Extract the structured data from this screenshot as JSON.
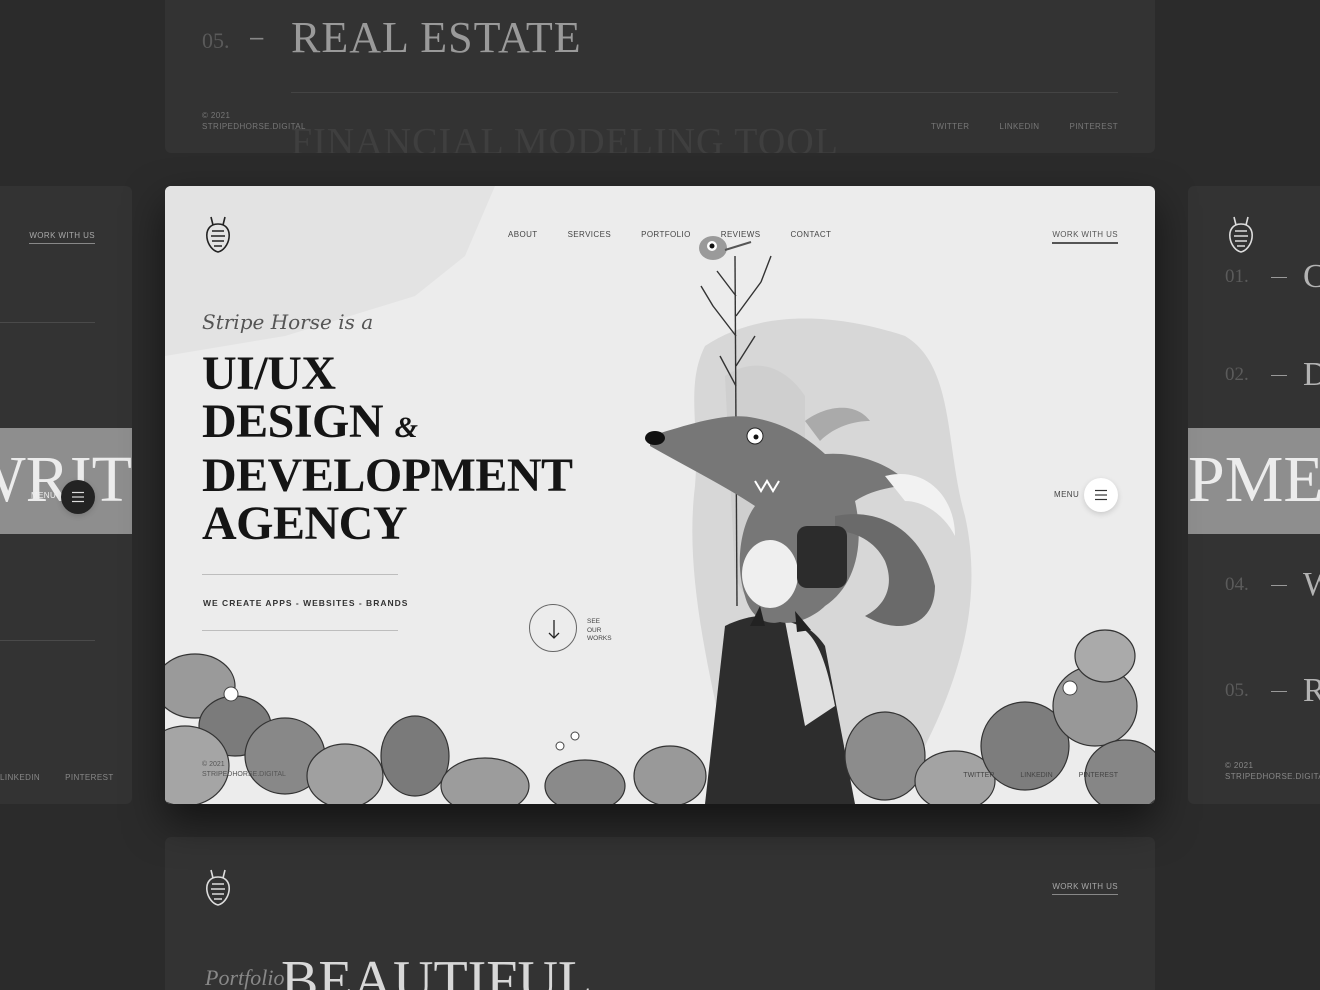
{
  "top_card": {
    "number": "05.",
    "dash": "–",
    "title": "REAL ESTATE",
    "ghost_title": "FINANCIAL MODELING TOOL",
    "copyright": "© 2021",
    "domain": "STRIPEDHORSE.DIGITAL",
    "socials": [
      "TWITTER",
      "LINKEDIN",
      "PINTEREST"
    ]
  },
  "left_card": {
    "work_with_us": "WORK WITH US",
    "band_text": "WRIT",
    "menu_label": "MENU",
    "socials": [
      "LINKEDIN",
      "PINTEREST"
    ]
  },
  "right_card": {
    "items": [
      {
        "num": "01.",
        "label": "C"
      },
      {
        "num": "02.",
        "label": "D"
      },
      {
        "num": "04.",
        "label": "W"
      },
      {
        "num": "05.",
        "label": "R"
      }
    ],
    "band_text": "PMEN",
    "copyright": "© 2021",
    "domain": "STRIPEDHORSE.DIGITAL"
  },
  "main": {
    "nav": [
      "ABOUT",
      "SERVICES",
      "PORTFOLIO",
      "REVIEWS",
      "CONTACT"
    ],
    "work_with_us": "WORK WITH US",
    "tagline": "Stripe Horse is a",
    "hero_line1": "UI/UX",
    "hero_line2": "DESIGN",
    "hero_amp": "&",
    "hero_line3": "DEVELOPMENT",
    "hero_line4": "AGENCY",
    "services_tag": "WE CREATE APPS  -  WEBSITES  -  BRANDS",
    "see_works": [
      "SEE",
      "OUR",
      "WORKS"
    ],
    "menu_label": "MENU",
    "copyright": "© 2021",
    "domain": "STRIPEDHORSE.DIGITAL",
    "socials": [
      "TWITTER",
      "LINKEDIN",
      "PINTEREST"
    ]
  },
  "bottom_card": {
    "work_with_us": "WORK WITH US",
    "script": "Portfolio",
    "title": "BEAUTIFUL"
  },
  "icons": {
    "logo": "horse-logo-icon",
    "menu": "hamburger-icon",
    "arrow": "arrow-down-icon"
  }
}
